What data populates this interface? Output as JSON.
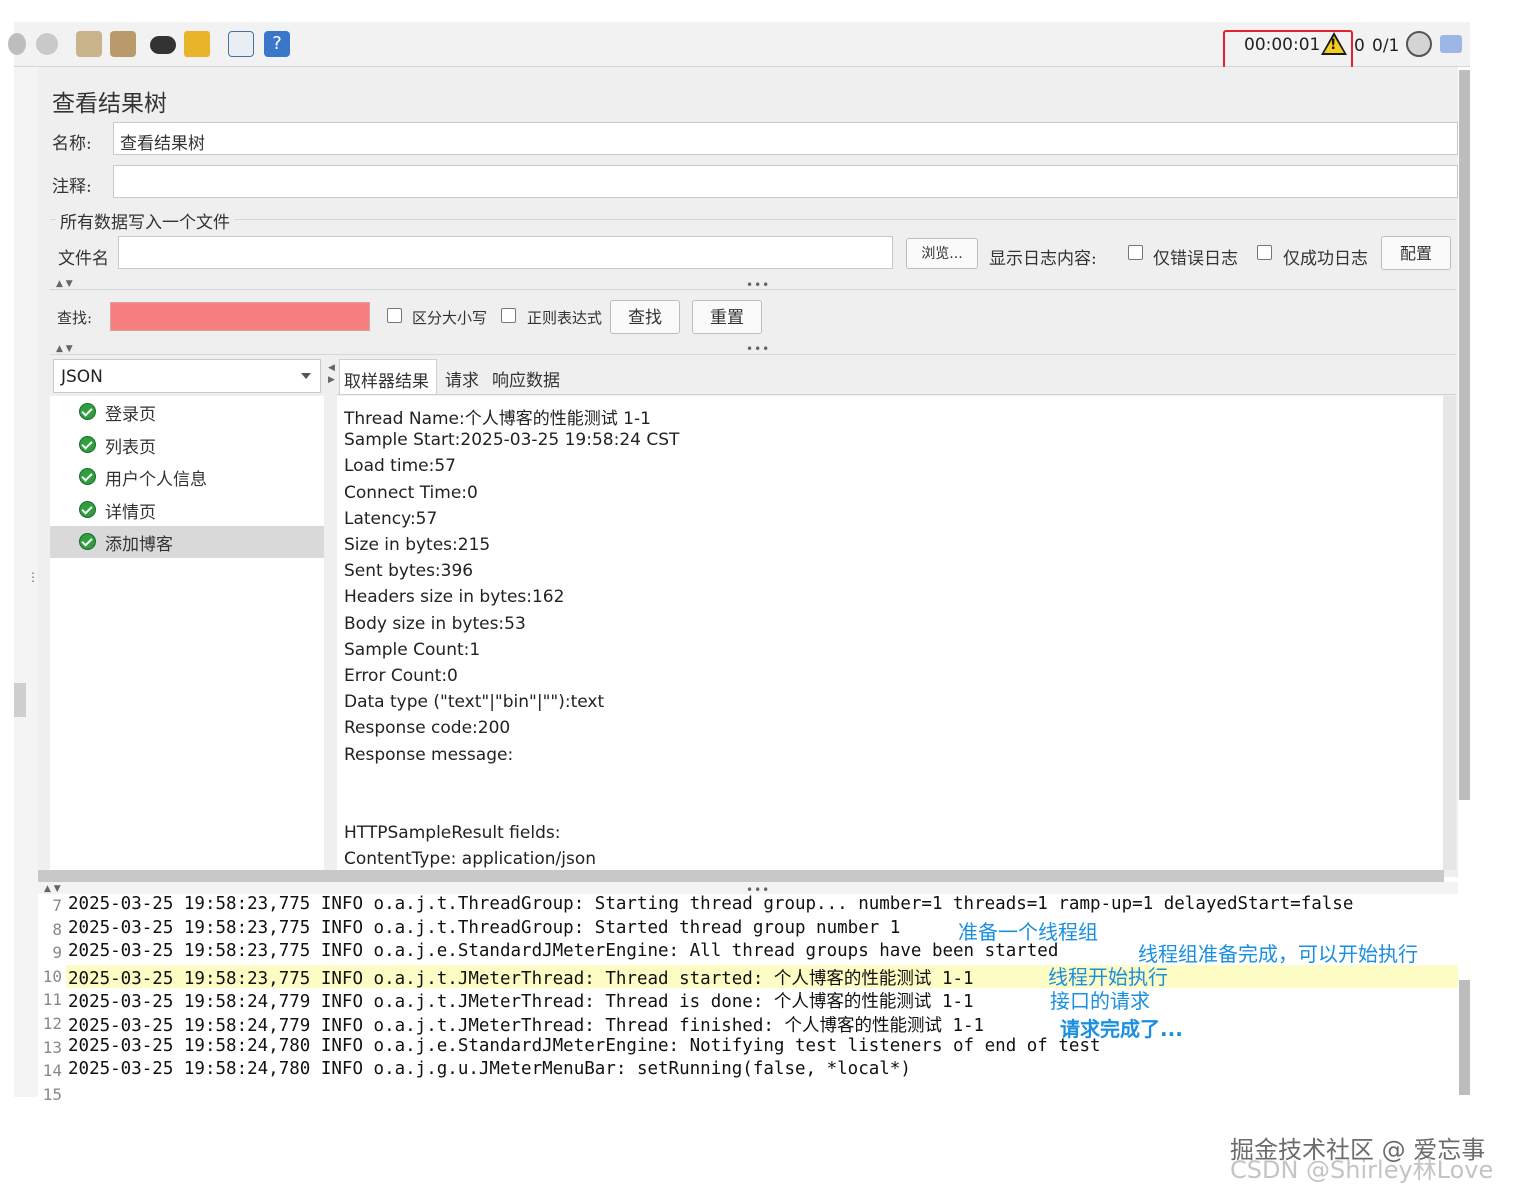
{
  "toolbar": {
    "timer": "00:00:01",
    "error_count": "0",
    "thread_count": "0/1"
  },
  "panel": {
    "title": "查看结果树",
    "name_label": "名称:",
    "name_value": "查看结果树",
    "comment_label": "注释:",
    "file_section_label": "所有数据写入一个文件",
    "filename_label": "文件名",
    "browse_button": "浏览...",
    "log_display_label": "显示日志内容:",
    "errors_only_label": "仅错误日志",
    "success_only_label": "仅成功日志",
    "configure_button": "配置",
    "search_label": "查找:",
    "case_sensitive_label": "区分大小写",
    "regex_label": "正则表达式",
    "find_button": "查找",
    "reset_button": "重置",
    "renderer_selected": "JSON",
    "tabs": [
      "取样器结果",
      "请求",
      "响应数据"
    ]
  },
  "tree": {
    "items": [
      "登录页",
      "列表页",
      "用户个人信息",
      "详情页",
      "添加博客"
    ],
    "selected_index": 4
  },
  "result": {
    "lines": [
      "Thread Name:个人博客的性能测试 1-1",
      "Sample Start:2025-03-25 19:58:24 CST",
      "Load time:57",
      "Connect Time:0",
      "Latency:57",
      "Size in bytes:215",
      "Sent bytes:396",
      "Headers size in bytes:162",
      "Body size in bytes:53",
      "Sample Count:1",
      "Error Count:0",
      "Data type (\"text\"|\"bin\"|\"\"):text",
      "Response code:200",
      "Response message:",
      "",
      "",
      "HTTPSampleResult fields:",
      "ContentType: application/json"
    ]
  },
  "log": {
    "lines": [
      {
        "num": "7",
        "text": "2025-03-25 19:58:23,775 INFO o.a.j.t.ThreadGroup: Starting thread group... number=1 threads=1 ramp-up=1 delayedStart=false"
      },
      {
        "num": "8",
        "text": "2025-03-25 19:58:23,775 INFO o.a.j.t.ThreadGroup: Started thread group number 1"
      },
      {
        "num": "9",
        "text": "2025-03-25 19:58:23,775 INFO o.a.j.e.StandardJMeterEngine: All thread groups have been started"
      },
      {
        "num": "10",
        "text": "2025-03-25 19:58:23,775 INFO o.a.j.t.JMeterThread: Thread started: 个人博客的性能测试 1-1"
      },
      {
        "num": "11",
        "text": "2025-03-25 19:58:24,779 INFO o.a.j.t.JMeterThread: Thread is done: 个人博客的性能测试 1-1"
      },
      {
        "num": "12",
        "text": "2025-03-25 19:58:24,779 INFO o.a.j.t.JMeterThread: Thread finished: 个人博客的性能测试 1-1"
      },
      {
        "num": "13",
        "text": "2025-03-25 19:58:24,780 INFO o.a.j.e.StandardJMeterEngine: Notifying test listeners of end of test"
      },
      {
        "num": "14",
        "text": "2025-03-25 19:58:24,780 INFO o.a.j.g.u.JMeterMenuBar: setRunning(false, *local*)"
      },
      {
        "num": "15",
        "text": ""
      }
    ],
    "highlight_index": 3,
    "annotations": [
      "准备一个线程组",
      "线程组准备完成，可以开始执行",
      "线程开始执行",
      "接口的请求",
      "请求完成了..."
    ]
  },
  "watermark": {
    "line1": "掘金技术社区 @ 爱忘事",
    "line2": "CSDN @Shirley林Love"
  },
  "colors": {
    "search_field": "#f77f7f",
    "highlight_row": "#fdfcc4",
    "annotation": "#1a8fe0",
    "timer_box": "#e0242a"
  }
}
